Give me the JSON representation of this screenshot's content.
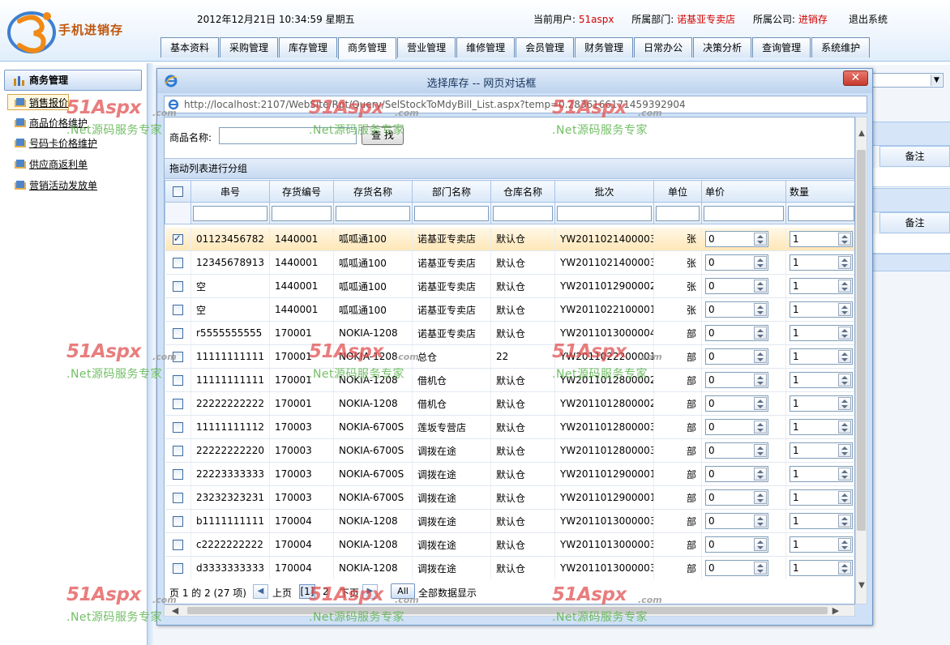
{
  "app": {
    "logo_text": "手机进销存",
    "datetime": "2012年12月21日  10:34:59 星期五"
  },
  "userinfo": {
    "user_label": "当前用户:",
    "user": "51aspx",
    "dept_label": "所属部门:",
    "dept": "诺基亚专卖店",
    "company_label": "所属公司:",
    "company": "进销存",
    "logout": "退出系统"
  },
  "nav_tabs": [
    "基本资料",
    "采购管理",
    "库存管理",
    "商务管理",
    "营业管理",
    "维修管理",
    "会员管理",
    "财务管理",
    "日常办公",
    "决策分析",
    "查询管理",
    "系统维护"
  ],
  "sidebar": {
    "title": "商务管理",
    "items": [
      "销售报价",
      "商品价格维护",
      "号码卡价格维护",
      "供应商返利单",
      "营销活动发放单"
    ]
  },
  "background": {
    "remark_label_1": "备注",
    "remark_label_2": "备注"
  },
  "dialog": {
    "title": "选择库存 -- 网页对话框",
    "close": "✕",
    "url": "http://localhost:2107/WebSite/Rpt/Query/SelStockToMdyBill_List.aspx?temp=0.2836166171459392904",
    "search_label": "商品名称:",
    "search_value": "",
    "search_button": "查 找",
    "group_panel": "拖动列表进行分组",
    "columns": [
      "串号",
      "存货编号",
      "存货名称",
      "部门名称",
      "仓库名称",
      "批次",
      "单位",
      "单价",
      "数量"
    ],
    "rows": [
      {
        "checked": true,
        "serial": "01123456782",
        "code": "1440001",
        "name": "呱呱通100",
        "dept": "诺基亚专卖店",
        "warehouse": "默认仓",
        "batch": "YW2011021400003",
        "unit": "张",
        "price": "0",
        "qty": "1"
      },
      {
        "checked": false,
        "serial": "12345678913",
        "code": "1440001",
        "name": "呱呱通100",
        "dept": "诺基亚专卖店",
        "warehouse": "默认仓",
        "batch": "YW2011021400003",
        "unit": "张",
        "price": "0",
        "qty": "1"
      },
      {
        "checked": false,
        "serial": "空",
        "code": "1440001",
        "name": "呱呱通100",
        "dept": "诺基亚专卖店",
        "warehouse": "默认仓",
        "batch": "YW2011012900002",
        "unit": "张",
        "price": "0",
        "qty": "1"
      },
      {
        "checked": false,
        "serial": "空",
        "code": "1440001",
        "name": "呱呱通100",
        "dept": "诺基亚专卖店",
        "warehouse": "默认仓",
        "batch": "YW2011022100001",
        "unit": "张",
        "price": "0",
        "qty": "1"
      },
      {
        "checked": false,
        "serial": "r5555555555",
        "code": "170001",
        "name": "NOKIA-1208",
        "dept": "诺基亚专卖店",
        "warehouse": "默认仓",
        "batch": "YW2011013000004",
        "unit": "部",
        "price": "0",
        "qty": "1"
      },
      {
        "checked": false,
        "serial": "11111111111",
        "code": "170001",
        "name": "NOKIA-1208",
        "dept": "总仓",
        "warehouse": "22",
        "batch": "YW2011022200001",
        "unit": "部",
        "price": "0",
        "qty": "1"
      },
      {
        "checked": false,
        "serial": "11111111111",
        "code": "170001",
        "name": "NOKIA-1208",
        "dept": "借机仓",
        "warehouse": "默认仓",
        "batch": "YW2011012800002",
        "unit": "部",
        "price": "0",
        "qty": "1"
      },
      {
        "checked": false,
        "serial": "22222222222",
        "code": "170001",
        "name": "NOKIA-1208",
        "dept": "借机仓",
        "warehouse": "默认仓",
        "batch": "YW2011012800002",
        "unit": "部",
        "price": "0",
        "qty": "1"
      },
      {
        "checked": false,
        "serial": "11111111112",
        "code": "170003",
        "name": "NOKIA-6700S",
        "dept": "莲坂专营店",
        "warehouse": "默认仓",
        "batch": "YW2011012800003",
        "unit": "部",
        "price": "0",
        "qty": "1"
      },
      {
        "checked": false,
        "serial": "22222222220",
        "code": "170003",
        "name": "NOKIA-6700S",
        "dept": "调拨在途",
        "warehouse": "默认仓",
        "batch": "YW2011012800003",
        "unit": "部",
        "price": "0",
        "qty": "1"
      },
      {
        "checked": false,
        "serial": "22223333333",
        "code": "170003",
        "name": "NOKIA-6700S",
        "dept": "调拨在途",
        "warehouse": "默认仓",
        "batch": "YW2011012900001",
        "unit": "部",
        "price": "0",
        "qty": "1"
      },
      {
        "checked": false,
        "serial": "23232323231",
        "code": "170003",
        "name": "NOKIA-6700S",
        "dept": "调拨在途",
        "warehouse": "默认仓",
        "batch": "YW2011012900001",
        "unit": "部",
        "price": "0",
        "qty": "1"
      },
      {
        "checked": false,
        "serial": "b1111111111",
        "code": "170004",
        "name": "NOKIA-1208",
        "dept": "调拨在途",
        "warehouse": "默认仓",
        "batch": "YW2011013000003",
        "unit": "部",
        "price": "0",
        "qty": "1"
      },
      {
        "checked": false,
        "serial": "c2222222222",
        "code": "170004",
        "name": "NOKIA-1208",
        "dept": "调拨在途",
        "warehouse": "默认仓",
        "batch": "YW2011013000003",
        "unit": "部",
        "price": "0",
        "qty": "1"
      },
      {
        "checked": false,
        "serial": "d3333333333",
        "code": "170004",
        "name": "NOKIA-1208",
        "dept": "调拨在途",
        "warehouse": "默认仓",
        "batch": "YW2011013000003",
        "unit": "部",
        "price": "0",
        "qty": "1"
      }
    ],
    "pager": {
      "info": "页 1 的 2 (27 项)",
      "prev": "上页",
      "current": "[1]",
      "page2": "2",
      "next": "下页",
      "all": "All",
      "show_all": "全部数据显示"
    }
  },
  "watermark": {
    "brand": "51Aspx",
    "suffix": ".com",
    "tagline": ".Net源码服务专家"
  },
  "colors": {
    "accent_red": "#d40000",
    "header_bg": "#dfeefc",
    "grid_border": "#a9c3e6",
    "selected_row": "#ffe7b8"
  },
  "icons": {
    "close": "close-icon",
    "ie": "ie-icon",
    "module": "module-icon",
    "menu": "menu-item-icon",
    "checkbox": "checkbox-icon",
    "spinner": "spinner-icon"
  }
}
